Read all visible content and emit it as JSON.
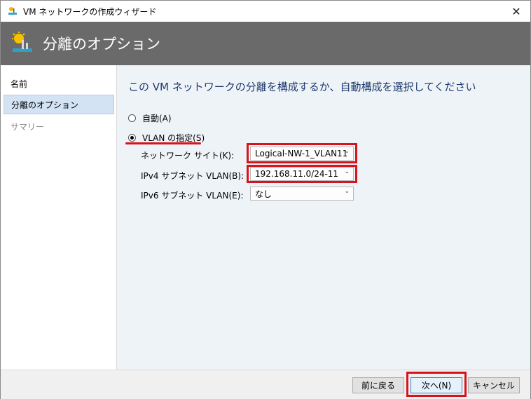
{
  "window": {
    "title": "VM ネットワークの作成ウィザード",
    "close_label": "✕"
  },
  "header": {
    "title": "分離のオプション"
  },
  "sidebar": {
    "items": [
      {
        "label": "名前",
        "state": "normal"
      },
      {
        "label": "分離のオプション",
        "state": "active"
      },
      {
        "label": "サマリー",
        "state": "disabled"
      }
    ]
  },
  "main": {
    "heading": "この VM ネットワークの分離を構成するか、自動構成を選択してください",
    "options": [
      {
        "label": "自動(A)",
        "checked": false
      },
      {
        "label": "VLAN の指定(S)",
        "checked": true
      }
    ],
    "fields": [
      {
        "label": "ネットワーク サイト(K):",
        "value": "Logical-NW-1_VLAN11"
      },
      {
        "label": "IPv4 サブネット VLAN(B):",
        "value": "192.168.11.0/24-11"
      },
      {
        "label": "IPv6 サブネット VLAN(E):",
        "value": "なし"
      }
    ]
  },
  "footer": {
    "back_label": "前に戻る",
    "next_label": "次へ(N)",
    "cancel_label": "キャンセル"
  },
  "colors": {
    "highlight": "#d8131b",
    "header_bg": "#6a6a6a",
    "heading_text": "#1e3a6e",
    "sidebar_active": "#d3e3f4"
  }
}
